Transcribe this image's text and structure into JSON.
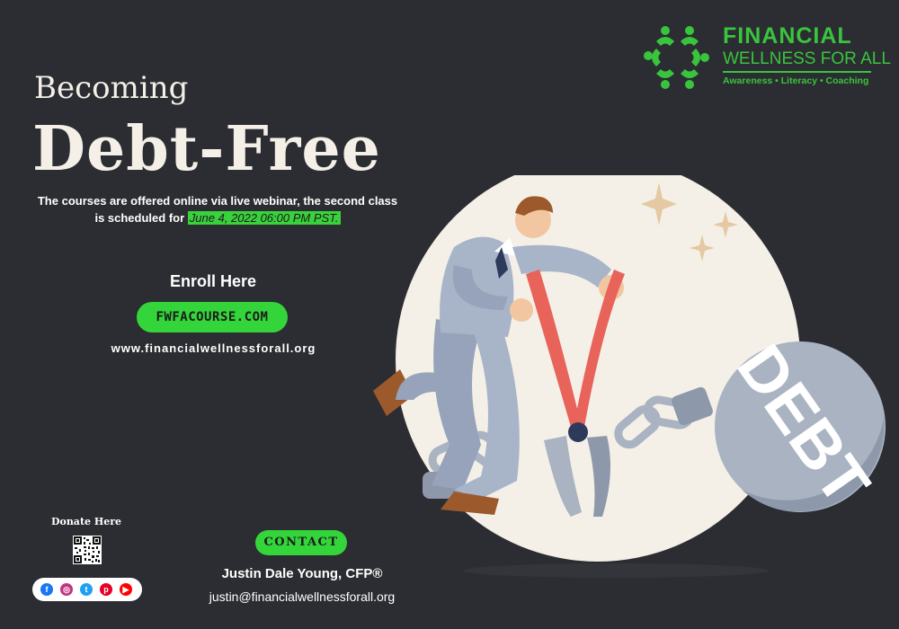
{
  "logo": {
    "line1": "FINANCIAL",
    "line2": "WELLNESS FOR ALL",
    "tagline": "Awareness • Literacy • Coaching"
  },
  "headline": {
    "small": "Becoming",
    "big": "Debt-Free"
  },
  "description": {
    "line1": "The courses are offered online via live webinar, the second class",
    "line2_prefix": "is scheduled for",
    "date_highlight": "June 4, 2022 06:00 PM PST."
  },
  "enroll": {
    "heading": "Enroll Here",
    "button_label": "FWFACOURSE.COM",
    "website": "www.financialwellnessforall.org"
  },
  "donate": {
    "label": "Donate Here"
  },
  "social": {
    "icons": [
      "facebook-icon",
      "instagram-icon",
      "twitter-icon",
      "pinterest-icon",
      "youtube-icon"
    ],
    "colors": [
      "#1877f2",
      "#c13584",
      "#1da1f2",
      "#e60023",
      "#ff0000"
    ]
  },
  "contact": {
    "button_label": "CONTACT",
    "name": "Justin Dale Young, CFP®",
    "email": "justin@financialwellnessforall.org"
  },
  "illustration": {
    "ball_text": "DEBT"
  },
  "colors": {
    "background": "#2c2d32",
    "accent_green": "#34d53a",
    "cream": "#f4f0e7"
  }
}
